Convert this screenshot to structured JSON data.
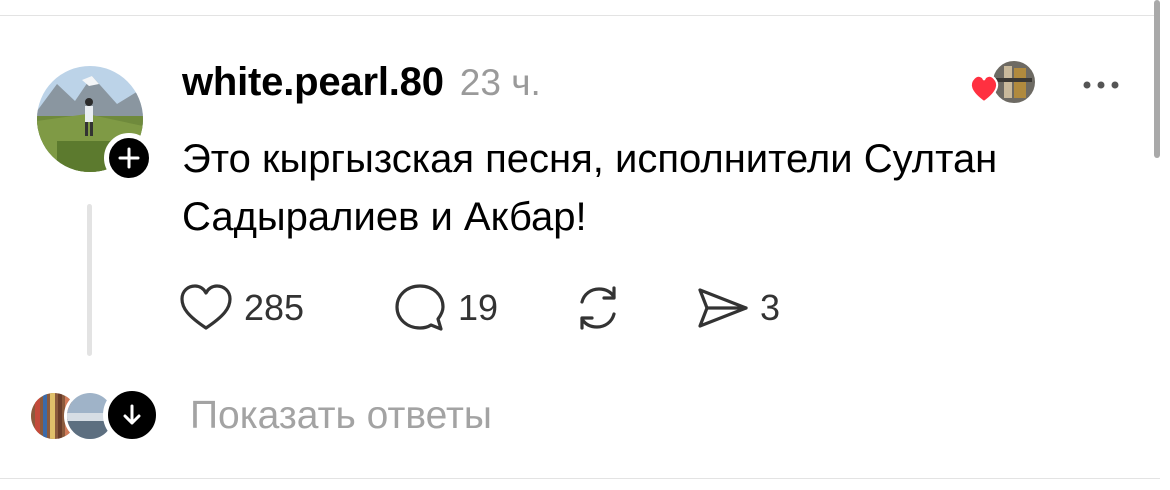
{
  "comment": {
    "username": "white.pearl.80",
    "timestamp": "23 ч.",
    "text": "Это кыргызская песня, исполнители Султан Садыралиев и Акбар!",
    "likes": "285",
    "replies": "19",
    "shares": "3"
  },
  "replies_section": {
    "label": "Показать ответы"
  },
  "icons": {
    "follow": "plus-icon",
    "more": "ellipsis-icon",
    "like": "heart-icon",
    "reply": "speech-bubble-icon",
    "repost": "repost-icon",
    "share": "paper-plane-icon",
    "expand": "arrow-down-icon"
  },
  "colors": {
    "heart_red": "#ff3040",
    "muted_text": "#9a9a9a",
    "divider": "#e3e3e3"
  }
}
